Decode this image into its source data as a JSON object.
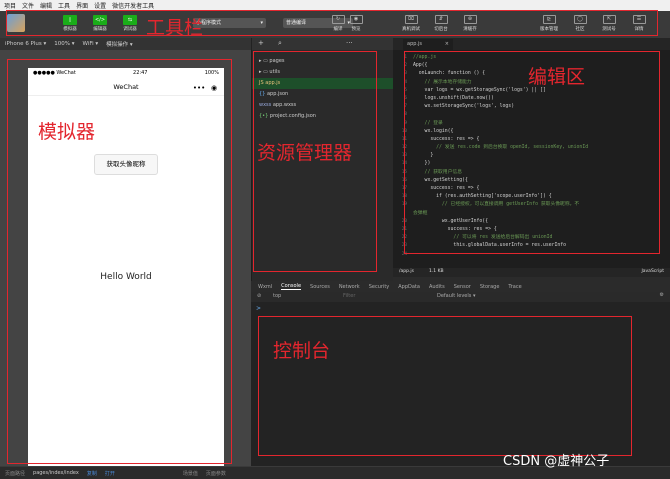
{
  "menu": [
    "项目",
    "文件",
    "编辑",
    "工具",
    "界面",
    "设置",
    "微信开发者工具"
  ],
  "toolbar": {
    "buttons": [
      {
        "label": "模拟器",
        "glyph": "▯"
      },
      {
        "label": "编辑器",
        "glyph": "</>"
      },
      {
        "label": "调试器",
        "glyph": "⇆"
      }
    ],
    "mode_select": "小程序模式",
    "compile_select": "普通编译",
    "right_tools": [
      {
        "label": "编译",
        "glyph": "↻"
      },
      {
        "label": "预览",
        "glyph": "◉"
      },
      {
        "label": "真机调试",
        "glyph": "⌧"
      },
      {
        "label": "切后台",
        "glyph": "⇵"
      },
      {
        "label": "清缓存",
        "glyph": "⊛"
      },
      {
        "label": "版本管理",
        "glyph": "⊵"
      },
      {
        "label": "社区",
        "glyph": "◯"
      },
      {
        "label": "测试号",
        "glyph": "⇱"
      },
      {
        "label": "详情",
        "glyph": "☰"
      }
    ]
  },
  "annotations": {
    "toolbar": "工具栏",
    "simulator": "模拟器",
    "explorer": "资源管理器",
    "editor": "编辑区",
    "console": "控制台"
  },
  "simulator": {
    "device": "iPhone 6 Plus ▾",
    "zoom": "100% ▾",
    "network": "WiFi ▾",
    "action": "模拟操作 ▾",
    "status": {
      "carrier": "●●●●● WeChat",
      "time": "22:47",
      "battery": "100%"
    },
    "nav_title": "WeChat",
    "capsule_dots": "•••",
    "capsule_close": "◉",
    "avatar_button": "获取头像昵称",
    "hello": "Hello World"
  },
  "explorer": {
    "add": "+",
    "search": "⌕",
    "more": "···",
    "files": [
      {
        "name": "pages",
        "icon": "▸ ▭",
        "selected": false
      },
      {
        "name": "utils",
        "icon": "▸ ▭",
        "selected": false
      },
      {
        "name": "app.js",
        "icon": "JS",
        "selected": true
      },
      {
        "name": "app.json",
        "icon": "{}",
        "selected": false
      },
      {
        "name": "app.wxss",
        "icon": "wxss",
        "selected": false
      },
      {
        "name": "project.config.json",
        "icon": "{•}",
        "selected": false
      }
    ]
  },
  "editor": {
    "tab": "app.js",
    "line_numbers": [
      "1",
      "2",
      "3",
      "4",
      "5",
      "6",
      "7",
      "8",
      "9",
      "10",
      "11",
      "12",
      "13",
      "14",
      "15",
      "16",
      "17",
      "18",
      "19",
      "",
      "20",
      "21",
      "22",
      "23",
      "24"
    ],
    "code": [
      "//app.js",
      "App({",
      "  onLaunch: function () {",
      "    // 展示本地存储能力",
      "    var logs = wx.getStorageSync('logs') || []",
      "    logs.unshift(Date.now())",
      "    wx.setStorageSync('logs', logs)",
      "",
      "    // 登录",
      "    wx.login({",
      "      success: res => {",
      "        // 发送 res.code 到后台换取 openId, sessionKey, unionId",
      "      }",
      "    })",
      "    // 获取用户信息",
      "    wx.getSetting({",
      "      success: res => {",
      "        if (res.authSetting['scope.userInfo']) {",
      "          // 已经授权，可以直接调用 getUserInfo 获取头像昵称，不",
      "会弹框",
      "          wx.getUserInfo({",
      "            success: res => {",
      "              // 可以将 res 发送给后台解码出 unionId",
      "              this.globalData.userInfo = res.userInfo",
      ""
    ],
    "status_path": "/app.js",
    "status_size": "1.1 KB",
    "status_lang": "JavaScript"
  },
  "console": {
    "tabs": [
      "Wxml",
      "Console",
      "Sources",
      "Network",
      "Security",
      "AppData",
      "Audits",
      "Sensor",
      "Storage",
      "Trace"
    ],
    "active_tab": "Console",
    "context": "top",
    "filter_placeholder": "Filter",
    "levels": "Default levels ▾",
    "prompt": ">"
  },
  "statusbar": {
    "path_label": "页面路径",
    "path": "pages/index/index",
    "copy": "复制",
    "open": "打开",
    "scene": "场景值",
    "params": "页面参数"
  },
  "watermark": "CSDN @虚神公子",
  "colors": {
    "accent_red": "#e3262e",
    "wechat_green": "#1aad19"
  }
}
